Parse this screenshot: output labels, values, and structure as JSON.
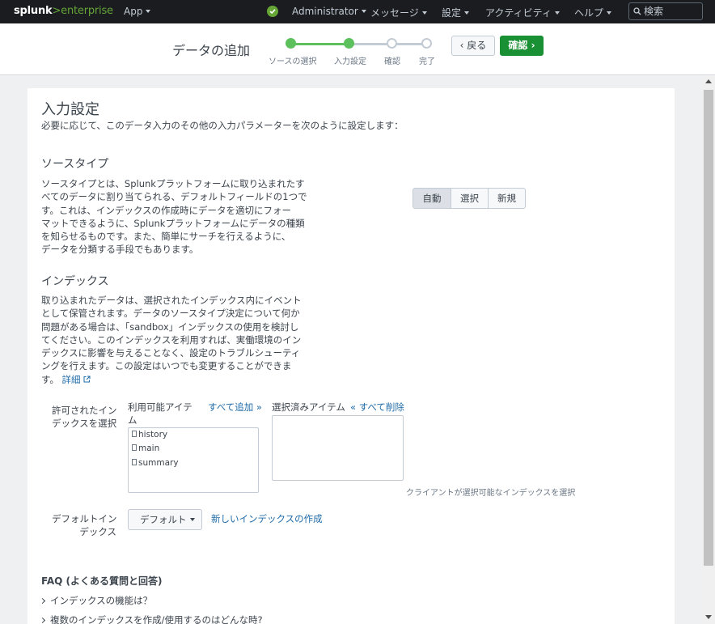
{
  "topnav": {
    "logo_brand": "splunk",
    "logo_gt": ">",
    "logo_product": "enterprise",
    "app_menu": "App",
    "user_menu": "Administrator",
    "messages_menu": "メッセージ",
    "settings_menu": "設定",
    "activity_menu": "アクティビティ",
    "help_menu": "ヘルプ",
    "search_placeholder": "検索"
  },
  "wizard": {
    "title": "データの追加",
    "steps": [
      {
        "label": "ソースの選択",
        "done": true
      },
      {
        "label": "入力設定",
        "done": true
      },
      {
        "label": "確認",
        "done": false
      },
      {
        "label": "完了",
        "done": false
      }
    ],
    "back_label": "戻る",
    "next_label": "確認",
    "colors": {
      "done": "#5cc05c",
      "next_button": "#1a9035"
    }
  },
  "main": {
    "title": "入力設定",
    "description": "必要に応じて、このデータ入力のその他の入力パラメーターを次のように設定します：",
    "sourcetype": {
      "heading": "ソースタイプ",
      "lines": [
        "ソースタイプとは、Splunkプラットフォームに取り込まれたす",
        "べてのデータに割り当てられる、デフォルトフィールドの1つで",
        "す。これは、インデックスの作成時にデータを適切にフォー",
        "マットできるように、Splunkプラットフォームにデータの種類",
        "を知らせるものです。また、簡単にサーチを行えるように、",
        "データを分類する手段でもあります。"
      ],
      "options": [
        "自動",
        "選択",
        "新規"
      ],
      "selected": "自動"
    },
    "index": {
      "heading": "インデックス",
      "lines": [
        "取り込まれたデータは、選択されたインデックス内にイベント",
        "として保管されます。データのソースタイプ決定について何か",
        "問題がある場合は、「sandbox」インデックスの使用を検討し",
        "てください。このインデックスを利用すれば、実働環境のイン",
        "デックスに影響を与えることなく、設定のトラブルシューティ",
        "ングを行えます。この設定はいつでも変更することができま",
        "す。"
      ],
      "learn_more": "詳細",
      "allowed_label_1": "許可されたイン",
      "allowed_label_2": "デックスを選択",
      "available_label_1": "利用可能アイテ",
      "available_label_2": "ム",
      "add_all": "すべて追加 »",
      "selected_label": "選択済みアイテム",
      "remove_all": "« すべて削除",
      "available_items": [
        "history",
        "main",
        "summary"
      ],
      "client_note": "クライアントが選択可能なインデックスを選択",
      "default_label_1": "デフォルトイン",
      "default_label_2": "デックス",
      "default_value": "デフォルト",
      "create_new": "新しいインデックスの作成"
    },
    "faq": {
      "heading": "FAQ (よくある質問と回答)",
      "items": [
        "インデックスの機能は？",
        "複数のインデックスを作成/使用するのはどんな時?"
      ]
    }
  }
}
